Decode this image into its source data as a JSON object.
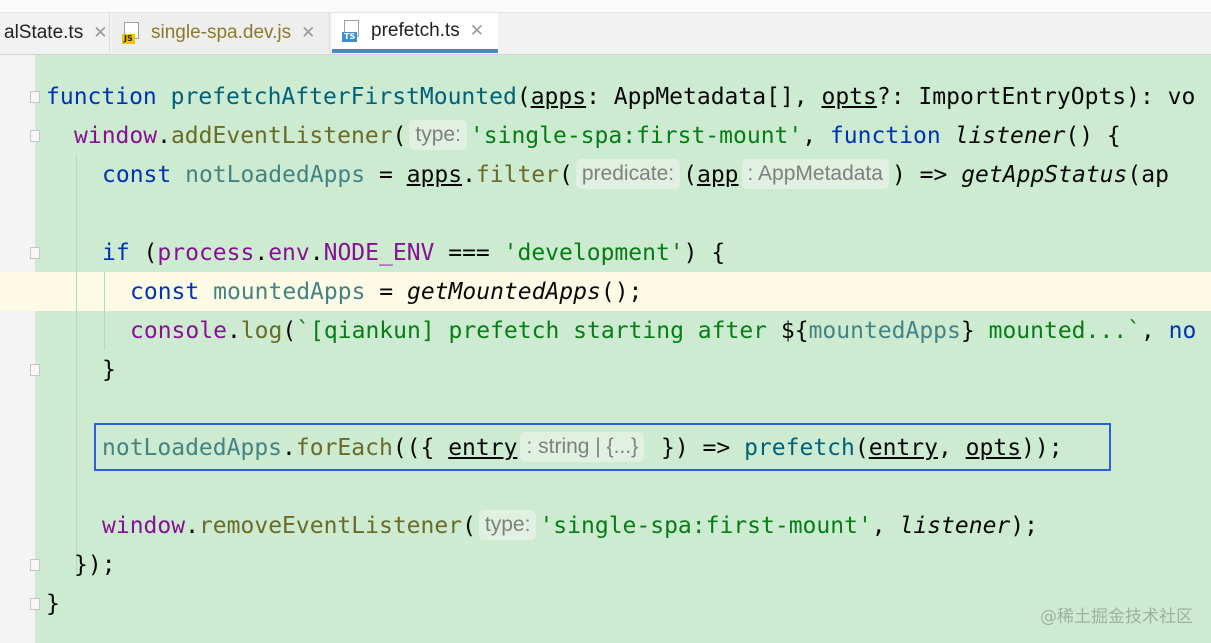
{
  "tabs": [
    {
      "label": "alState.ts",
      "icon": "ts-file-icon",
      "active": false
    },
    {
      "label": "single-spa.dev.js",
      "icon": "js-file-icon",
      "badge": "JS",
      "active": false
    },
    {
      "label": "prefetch.ts",
      "icon": "ts-file-icon",
      "badge": "TS",
      "active": true
    }
  ],
  "close_glyph": "✕",
  "code": {
    "l1": {
      "kw": "function",
      "name": "prefetchAfterFirstMounted",
      "p1": "(",
      "apps": "apps",
      "p2": ": AppMetadata[], ",
      "opts": "opts",
      "p3": "?: ImportEntryOpts): vo"
    },
    "l2": {
      "window": "window",
      "dot": ".",
      "method": "addEventListener",
      "p1": "(",
      "hint": "type:",
      "str": "'single-spa:first-mount'",
      "p2": ", ",
      "kw": "function",
      "sp": " ",
      "listener": "listener",
      "p3": "() {"
    },
    "l3": {
      "kw": "const",
      "name": "notLoadedApps",
      "p1": " = ",
      "apps": "apps",
      "dot": ".",
      "method": "filter",
      "p2": "(",
      "hint": "predicate:",
      "p3": "(",
      "app": "app",
      "hint2": ": AppMetadata",
      "p4": ") => ",
      "call": "getAppStatus",
      "p5": "(ap"
    },
    "l5": {
      "kw": "if",
      "p1": " (",
      "obj": "process",
      "d1": ".",
      "env": "env",
      "d2": ".",
      "key": "NODE_ENV",
      "p2": " === ",
      "str": "'development'",
      "p3": ") {"
    },
    "l6": {
      "kw": "const",
      "name": "mountedApps",
      "p1": " = ",
      "call": "getMountedApps",
      "p2": "();"
    },
    "l7": {
      "obj": "console",
      "dot": ".",
      "method": "log",
      "p1": "(",
      "s1": "`[qiankun] prefetch starting after ",
      "i1": "${",
      "var": "mountedApps",
      "i2": "}",
      "s2": " mounted...`",
      "p2": ", ",
      "tail": "no"
    },
    "l8": {
      "brace": "}"
    },
    "l10": {
      "name": "notLoadedApps",
      "dot": ".",
      "method": "forEach",
      "p1": "(({ ",
      "entry": "entry",
      "hint": ": string | {...}",
      "p2": " }) => ",
      "call": "prefetch",
      "p3": "(",
      "entry2": "entry",
      "p4": ", ",
      "opts": "opts",
      "p5": "));"
    },
    "l12": {
      "window": "window",
      "dot": ".",
      "method": "removeEventListener",
      "p1": "(",
      "hint": "type:",
      "str": "'single-spa:first-mount'",
      "p2": ", ",
      "listener": "listener",
      "p3": ");"
    },
    "l13": {
      "text": "});"
    },
    "l14": {
      "text": "}"
    }
  },
  "watermark": "@稀土掘金技术社区",
  "colors": {
    "editor_bg": "#cdebd0",
    "highlight_line": "#fdfbe6",
    "selection_box": "#2f5fd4",
    "active_tab_underline": "#4a88c7"
  }
}
